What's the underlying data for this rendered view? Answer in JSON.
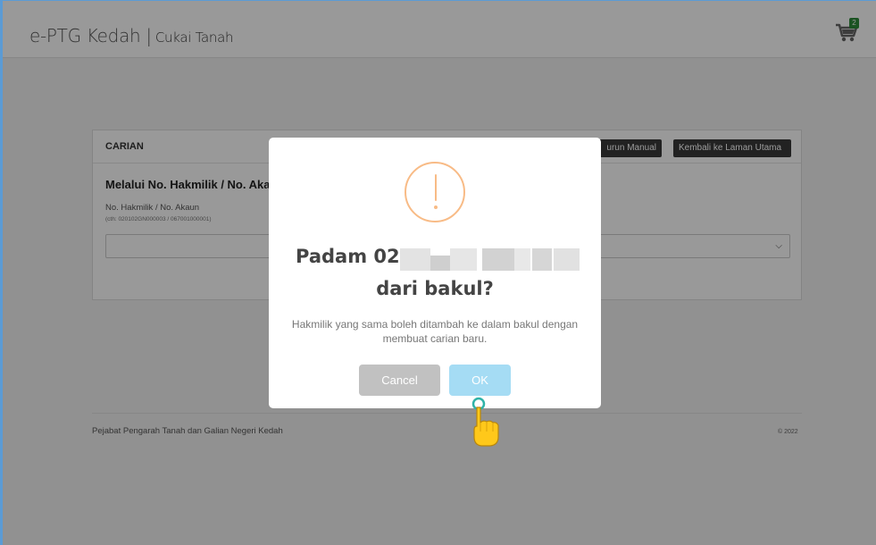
{
  "header": {
    "brand": "e-PTG Kedah",
    "separator": "|",
    "subtitle": "Cukai Tanah",
    "cart_icon": "cart-icon",
    "cart_count": "2"
  },
  "panel": {
    "title": "CARIAN",
    "manual_button": "urun Manual",
    "home_button": "Kembali ke Laman Utama",
    "section_title": "Melalui No. Hakmilik / No. Aka",
    "field_label": "No. Hakmilik / No. Akaun",
    "field_hint": "(cth: 020102GN000003 / 067001000001)"
  },
  "footer": {
    "left": "Pejabat Pengarah Tanah dan Galian Negeri Kedah",
    "right": "© 2022"
  },
  "modal": {
    "icon": "warning-icon",
    "title_prefix": "Padam 02",
    "title_suffix": "dari bakul?",
    "text": "Hakmilik yang sama boleh ditambah ke dalam bakul dengan membuat carian baru.",
    "cancel_label": "Cancel",
    "ok_label": "OK"
  },
  "colors": {
    "warning": "#f8bb86",
    "ok_button": "#a5dcf4",
    "cancel_button": "#c1c1c1",
    "badge": "#2e8b3a"
  }
}
